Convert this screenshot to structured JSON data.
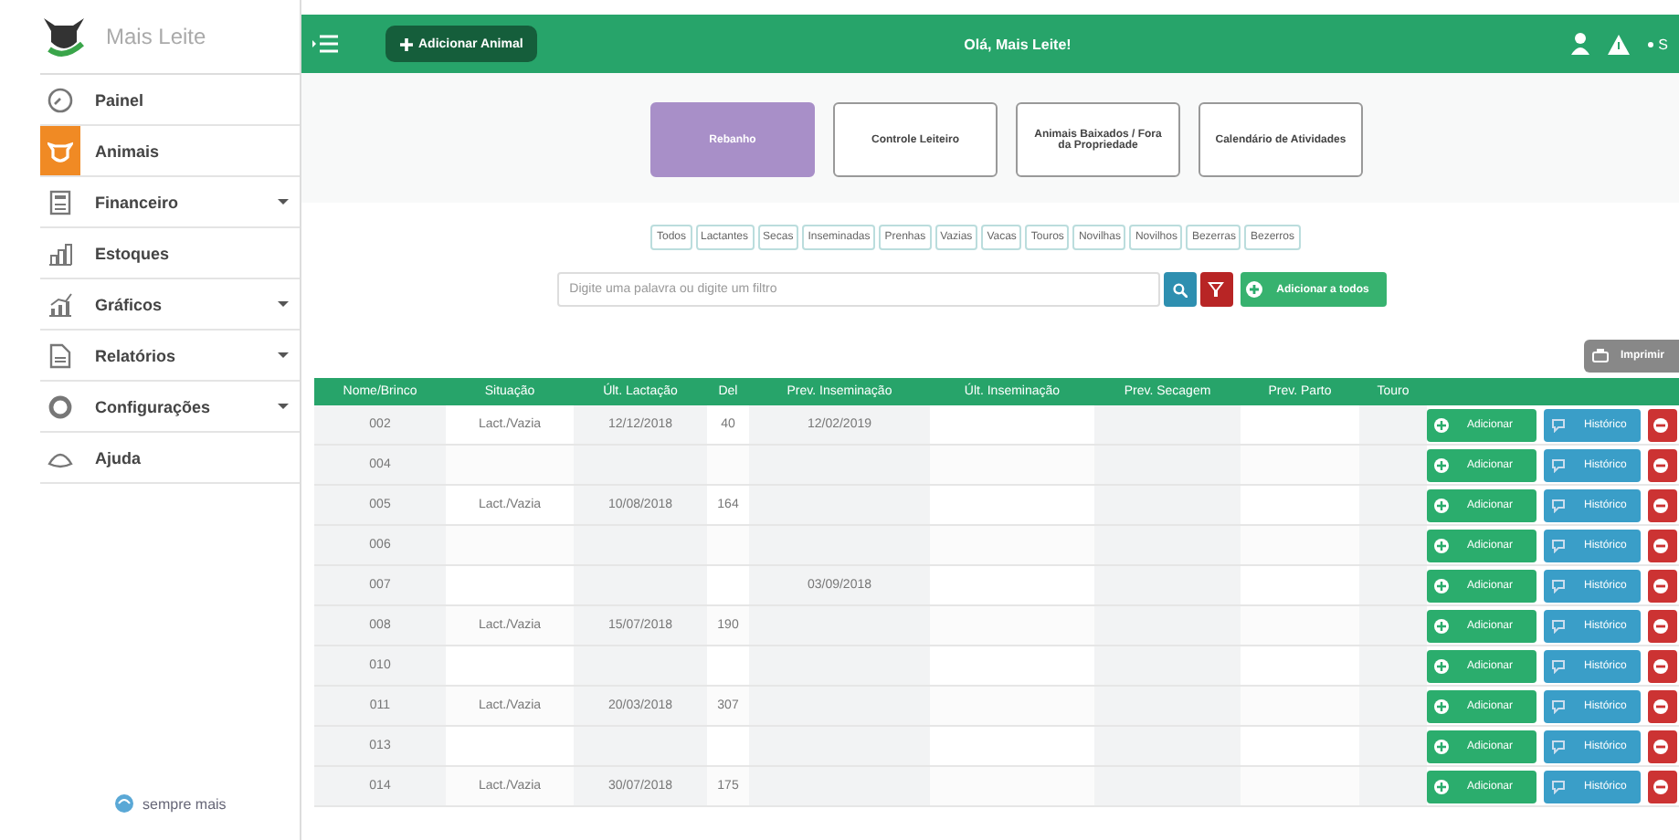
{
  "sidebar": {
    "brand": "Mais Leite",
    "items": [
      {
        "label": "Painel",
        "kind": "gauge",
        "selected": false,
        "has_submenu": false
      },
      {
        "label": "Animais",
        "kind": "cow",
        "selected": true,
        "has_submenu": false
      },
      {
        "label": "Financeiro",
        "kind": "calculator",
        "selected": false,
        "has_submenu": true
      },
      {
        "label": "Estoques",
        "kind": "stock",
        "selected": false,
        "has_submenu": false
      },
      {
        "label": "Gráficos",
        "kind": "chart",
        "selected": false,
        "has_submenu": true
      },
      {
        "label": "Relatórios",
        "kind": "document",
        "selected": false,
        "has_submenu": true
      },
      {
        "label": "Configurações",
        "kind": "ring",
        "selected": false,
        "has_submenu": true
      },
      {
        "label": "Ajuda",
        "kind": "help",
        "selected": false,
        "has_submenu": false
      }
    ],
    "footer": "sempre mais"
  },
  "top_bar": {
    "add_button": "Adicionar Animal",
    "greeting": "Olá, Mais Leite!",
    "menu_label": "S"
  },
  "sections": [
    {
      "label": "Rebanho",
      "selected": true
    },
    {
      "label": "Controle Leiteiro",
      "selected": false
    },
    {
      "label": "Animais Baixados / Fora da Propriedade",
      "selected": false
    },
    {
      "label": "Calendário de Atividades",
      "selected": false
    }
  ],
  "filters": [
    "Todos",
    "Lactantes",
    "Secas",
    "Inseminadas",
    "Prenhas",
    "Vazias",
    "Vacas",
    "Touros",
    "Novilhas",
    "Novilhos",
    "Bezerras",
    "Bezerros"
  ],
  "search": {
    "placeholder": "Digite uma palavra ou digite um filtro",
    "add_all_button": "Adicionar a todos"
  },
  "print_button": "Imprimir",
  "table": {
    "columns": [
      "Nome/Brinco",
      "Situação",
      "Últ. Lactação",
      "Del",
      "Prev. Inseminação",
      "Últ. Inseminação",
      "Prev. Secagem",
      "Prev. Parto",
      "Touro"
    ],
    "rows": [
      {
        "cells": [
          "002",
          "Lact./Vazia",
          "12/12/2018",
          "40",
          "12/02/2019",
          "",
          "",
          "",
          ""
        ],
        "actions": [
          "Adicionar",
          "Histórico"
        ]
      },
      {
        "cells": [
          "004",
          "",
          "",
          "",
          "",
          "",
          "",
          "",
          ""
        ],
        "actions": [
          "Adicionar",
          "Histórico"
        ]
      },
      {
        "cells": [
          "005",
          "Lact./Vazia",
          "10/08/2018",
          "164",
          "",
          "",
          "",
          "",
          ""
        ],
        "actions": [
          "Adicionar",
          "Histórico"
        ]
      },
      {
        "cells": [
          "006",
          "",
          "",
          "",
          "",
          "",
          "",
          "",
          ""
        ],
        "actions": [
          "Adicionar",
          "Histórico"
        ]
      },
      {
        "cells": [
          "007",
          "",
          "",
          "",
          "03/09/2018",
          "",
          "",
          "",
          ""
        ],
        "actions": [
          "Adicionar",
          "Histórico"
        ]
      },
      {
        "cells": [
          "008",
          "Lact./Vazia",
          "15/07/2018",
          "190",
          "",
          "",
          "",
          "",
          ""
        ],
        "actions": [
          "Adicionar",
          "Histórico"
        ]
      },
      {
        "cells": [
          "010",
          "",
          "",
          "",
          "",
          "",
          "",
          "",
          ""
        ],
        "actions": [
          "Adicionar",
          "Histórico"
        ]
      },
      {
        "cells": [
          "011",
          "Lact./Vazia",
          "20/03/2018",
          "307",
          "",
          "",
          "",
          "",
          ""
        ],
        "actions": [
          "Adicionar",
          "Histórico"
        ]
      },
      {
        "cells": [
          "013",
          "",
          "",
          "",
          "",
          "",
          "",
          "",
          ""
        ],
        "actions": [
          "Adicionar",
          "Histórico"
        ]
      },
      {
        "cells": [
          "014",
          "Lact./Vazia",
          "30/07/2018",
          "175",
          "",
          "",
          "",
          "",
          ""
        ],
        "actions": [
          "Adicionar",
          "Histórico"
        ]
      }
    ]
  }
}
